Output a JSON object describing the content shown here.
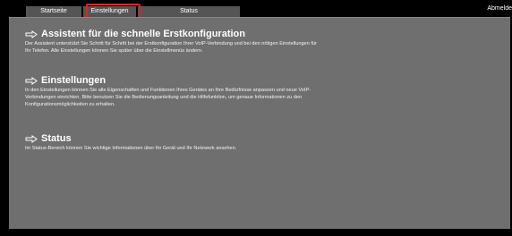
{
  "tabs": [
    {
      "label": "Startseite"
    },
    {
      "label": "Einstellungen"
    },
    {
      "label": "Status"
    }
  ],
  "logout_label": "Abmelde",
  "sections": [
    {
      "title": "Assistent für die schnelle Erstkonfiguration",
      "text": "Der Assistent unterstützt Sie Schritt für Schritt bei der Erstkonfiguration Ihrer VoIP-Verbindung und bei den nötigen Einstellungen für Ihr Telefon. Alle Einstellungen können Sie später über die Einstellmenüs ändern."
    },
    {
      "title": "Einstellungen",
      "text": "In den Einstellungen können Sie alle Eigenschaften und Funktionen Ihres Gerätes an Ihre Bedürfnisse anpassen und neue VoIP-Verbindungen einrichten. Bitte benutzen Sie die Bedienungsanleitung und die Hilfefunktion, um genaue Informationen zu den Konfigurationsmöglichkeiten zu erhalten."
    },
    {
      "title": "Status",
      "text": "Im Status-Bereich können Sie wichtige Informationen über Ihr Gerät und Ihr Netzwerk ansehen."
    }
  ],
  "colors": {
    "background": "#000000",
    "panel": "#6f6f6f",
    "tab": "#555555",
    "highlight": "#e02020"
  },
  "icons": [
    "arrow-right-icon"
  ]
}
